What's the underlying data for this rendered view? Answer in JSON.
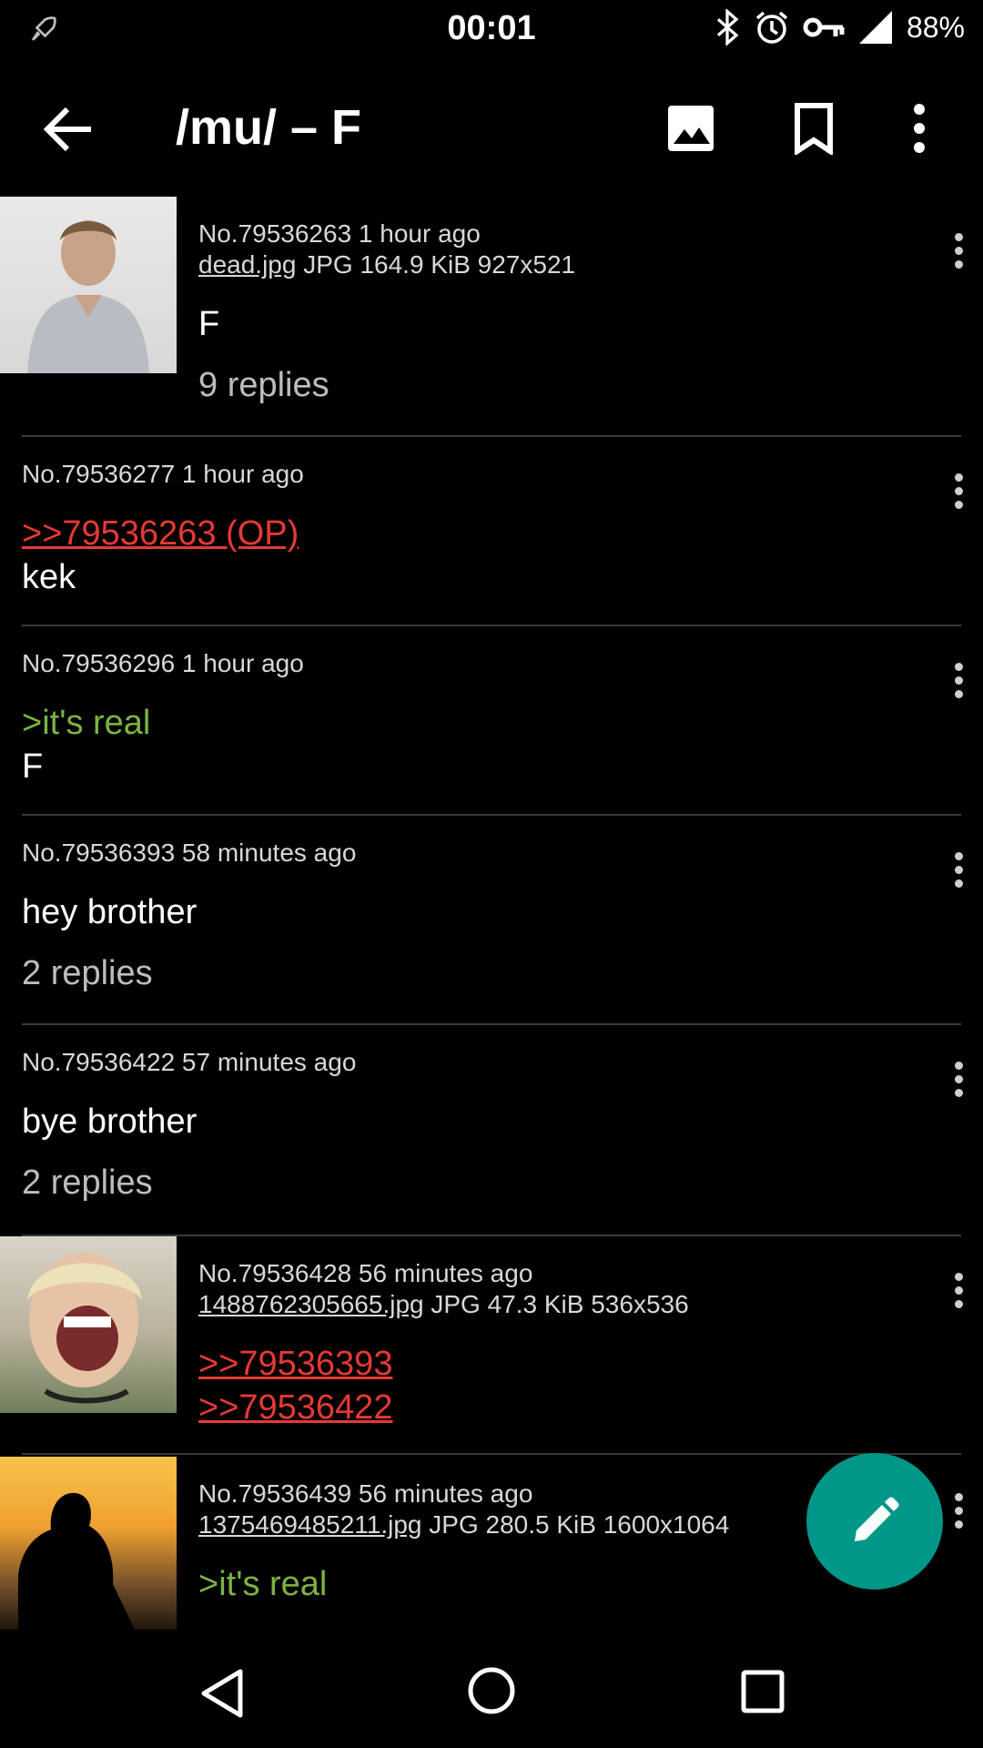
{
  "status_bar": {
    "time": "00:01",
    "battery": "88%"
  },
  "toolbar": {
    "title": "/mu/ – F"
  },
  "posts": [
    {
      "meta": "No.79536263 1 hour ago",
      "file_name": "dead.jpg",
      "file_info": "JPG 164.9 KiB 927x521",
      "text": "F",
      "replies": "9 replies"
    },
    {
      "meta": "No.79536277 1 hour ago",
      "quote": ">>79536263 (OP)",
      "text": "kek"
    },
    {
      "meta": "No.79536296 1 hour ago",
      "greentext": ">it's real",
      "text": "F"
    },
    {
      "meta": "No.79536393 58 minutes ago",
      "text": "hey brother",
      "replies": "2 replies"
    },
    {
      "meta": "No.79536422 57 minutes ago",
      "text": "bye brother",
      "replies": "2 replies"
    },
    {
      "meta": "No.79536428 56 minutes ago",
      "file_name": "1488762305665.jpg",
      "file_info": "JPG 47.3 KiB 536x536",
      "quote1": ">>79536393",
      "quote2": ">>79536422"
    },
    {
      "meta": "No.79536439 56 minutes ago",
      "file_name": "1375469485211.jpg",
      "file_info": "JPG 280.5 KiB 1600x1064",
      "greentext": ">it's real"
    }
  ],
  "icons": {
    "status": [
      "rocket-icon",
      "bluetooth-icon",
      "alarm-icon",
      "vpn-key-icon",
      "signal-icon"
    ],
    "toolbar": [
      "back-arrow-icon",
      "image-icon",
      "bookmark-icon",
      "more-vert-icon"
    ],
    "fab": "pencil-icon",
    "nav": [
      "nav-back-icon",
      "nav-home-icon",
      "nav-recents-icon"
    ]
  },
  "colors": {
    "quote": "#e53935",
    "greentext": "#7cb342",
    "fab": "#009688"
  }
}
